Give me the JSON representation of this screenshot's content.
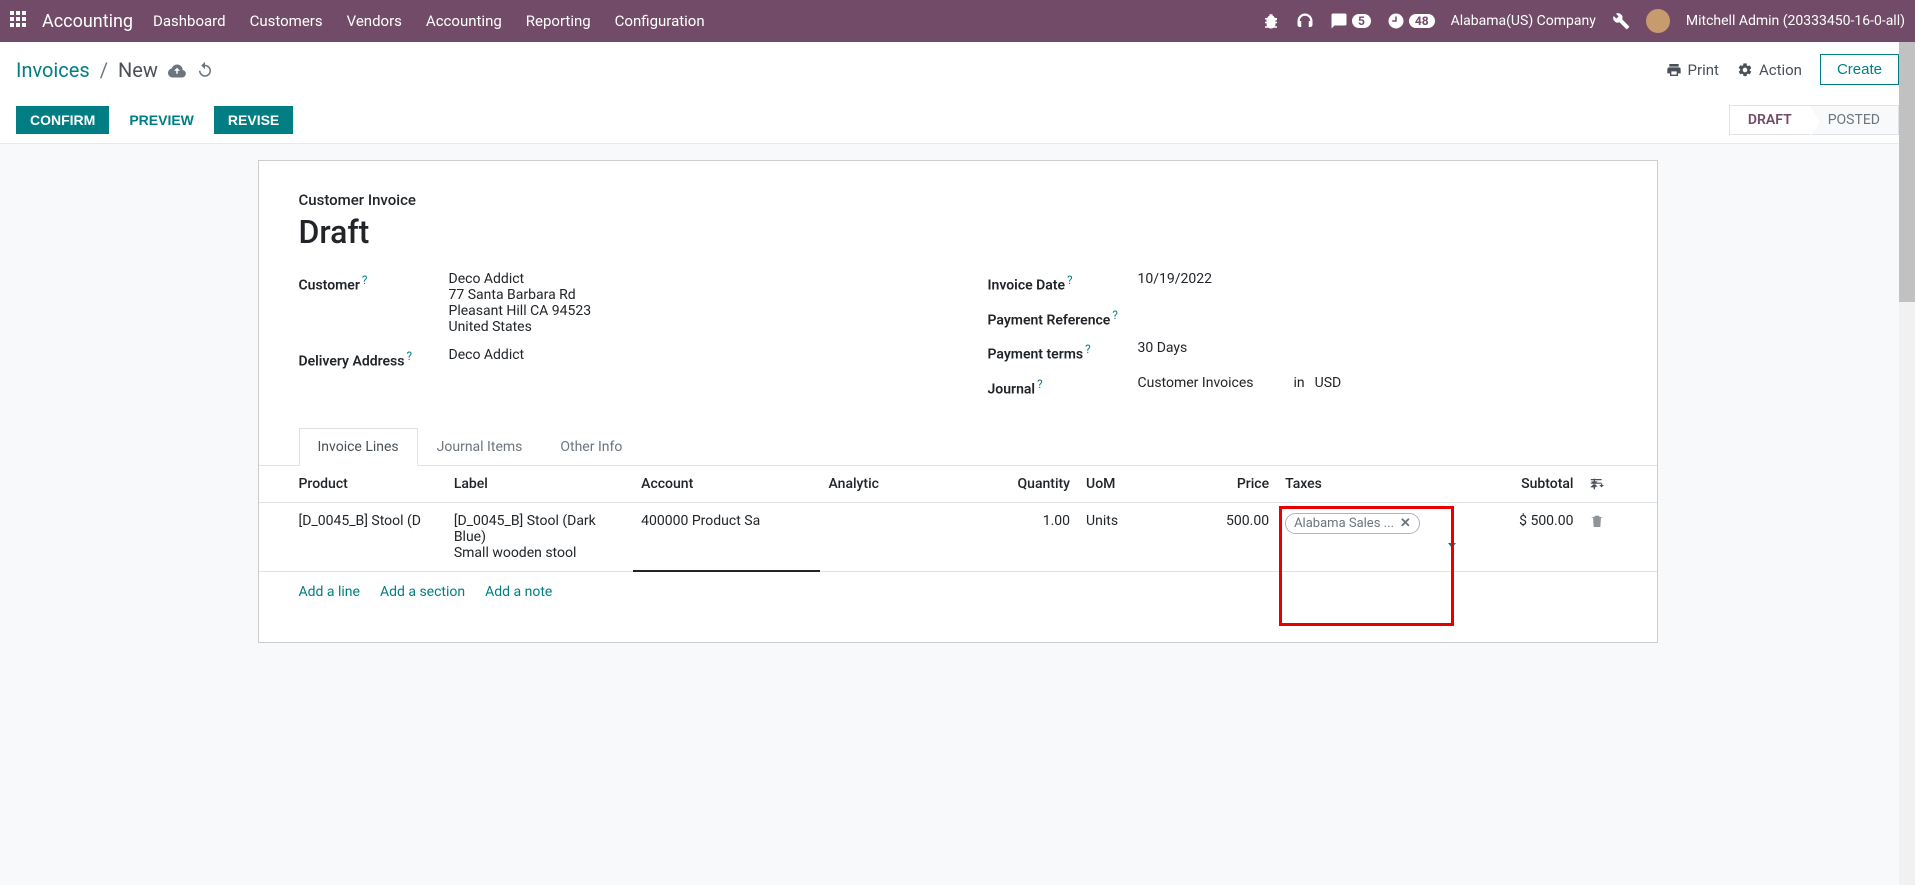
{
  "topnav": {
    "brand": "Accounting",
    "menu": [
      "Dashboard",
      "Customers",
      "Vendors",
      "Accounting",
      "Reporting",
      "Configuration"
    ],
    "chat_badge": "5",
    "activity_badge": "48",
    "company": "Alabama(US) Company",
    "user": "Mitchell Admin (20333450-16-0-all)"
  },
  "controlpanel": {
    "breadcrumb_root": "Invoices",
    "breadcrumb_current": "New",
    "print": "Print",
    "action": "Action",
    "create": "Create"
  },
  "statusbar": {
    "confirm": "CONFIRM",
    "preview": "PREVIEW",
    "revise": "REVISE",
    "draft": "DRAFT",
    "posted": "POSTED"
  },
  "form": {
    "subtitle": "Customer Invoice",
    "title": "Draft",
    "customer_label": "Customer",
    "customer_name": "Deco Addict",
    "customer_addr1": "77 Santa Barbara Rd",
    "customer_addr2": "Pleasant Hill CA 94523",
    "customer_addr3": "United States",
    "delivery_label": "Delivery Address",
    "delivery_value": "Deco Addict",
    "invoice_date_label": "Invoice Date",
    "invoice_date": "10/19/2022",
    "payment_ref_label": "Payment Reference",
    "payment_ref": "",
    "payment_terms_label": "Payment terms",
    "payment_terms": "30 Days",
    "journal_label": "Journal",
    "journal": "Customer Invoices",
    "journal_in": "in",
    "journal_currency": "USD"
  },
  "tabs": {
    "t1": "Invoice Lines",
    "t2": "Journal Items",
    "t3": "Other Info"
  },
  "table": {
    "headers": {
      "product": "Product",
      "label": "Label",
      "account": "Account",
      "analytic": "Analytic",
      "quantity": "Quantity",
      "uom": "UoM",
      "price": "Price",
      "taxes": "Taxes",
      "subtotal": "Subtotal"
    },
    "row": {
      "product": "[D_0045_B] Stool (D",
      "label": "[D_0045_B] Stool (Dark Blue)\nSmall wooden stool",
      "account": "400000 Product Sa",
      "quantity": "1.00",
      "uom": "Units",
      "price": "500.00",
      "tax_tag": "Alabama Sales ...",
      "subtotal": "$ 500.00"
    },
    "add_line": "Add a line",
    "add_section": "Add a section",
    "add_note": "Add a note"
  }
}
